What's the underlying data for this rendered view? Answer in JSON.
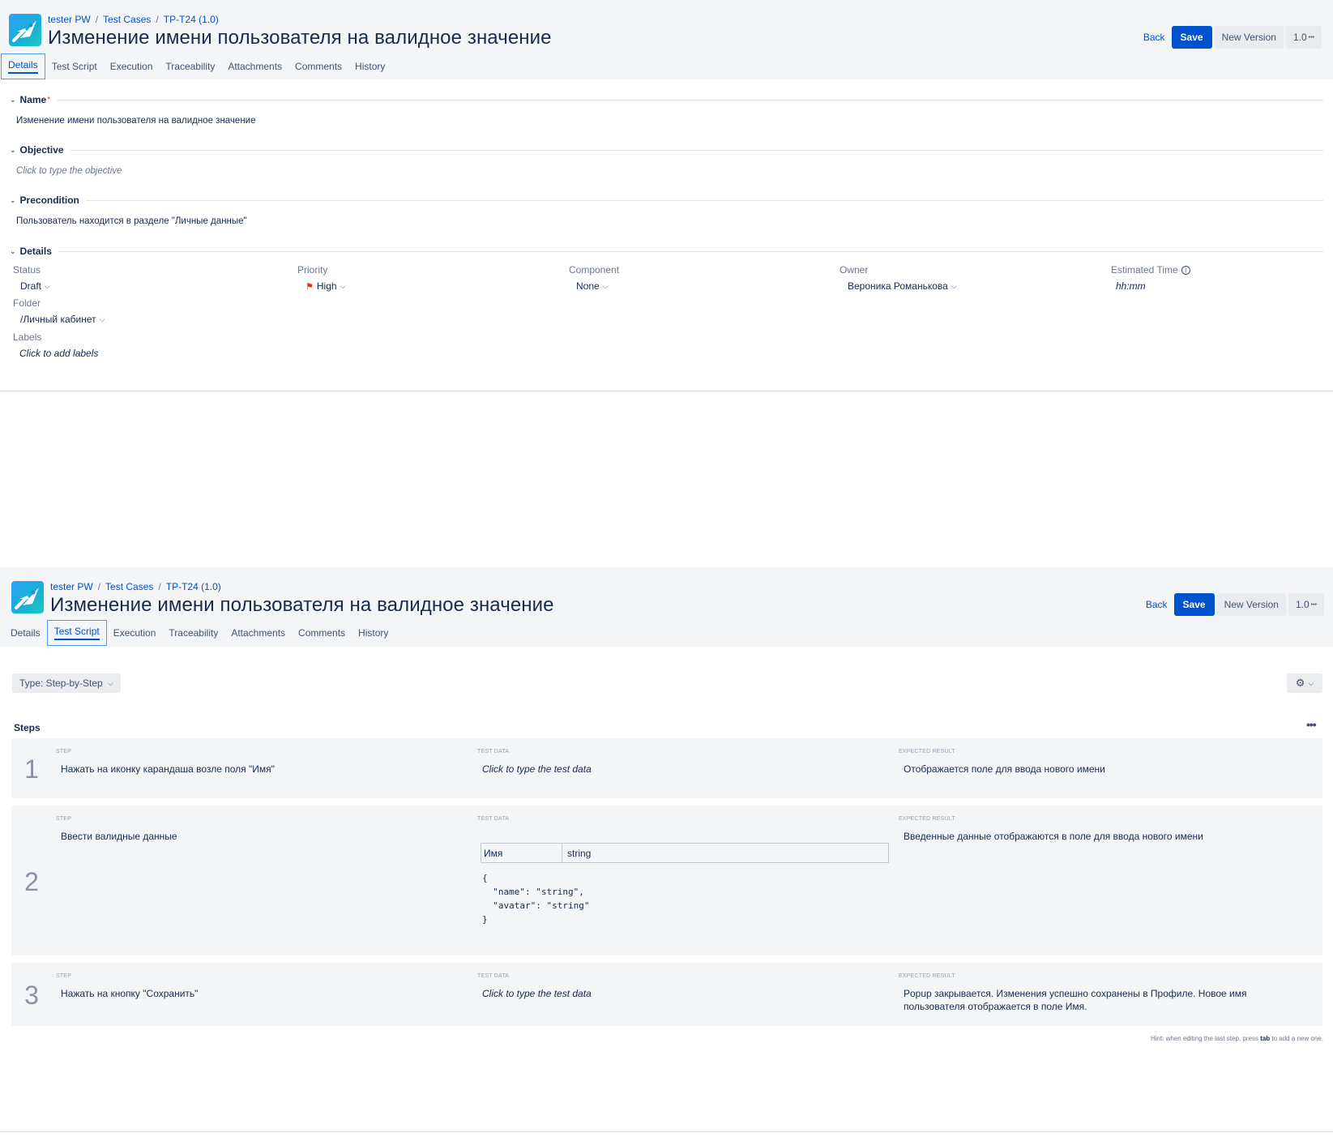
{
  "header": {
    "breadcrumb": [
      "tester PW",
      "Test Cases",
      "TP-T24 (1.0)"
    ],
    "breadcrumb_sep": "/",
    "title": "Изменение имени пользователя на валидное значение",
    "back_label": "Back",
    "save_label": "Save",
    "new_version_label": "New Version",
    "version_label": "1.0",
    "more_icon": "•••"
  },
  "tabs": [
    "Details",
    "Test Script",
    "Execution",
    "Traceability",
    "Attachments",
    "Comments",
    "History"
  ],
  "details": {
    "name_label": "Name",
    "name_required": "*",
    "name_value": "Изменение имени пользователя на валидное значение",
    "objective_label": "Objective",
    "objective_placeholder": "Click to type the objective",
    "precondition_label": "Precondition",
    "precondition_value": "Пользователь находится в разделе \"Личные данные\"",
    "details_label": "Details",
    "status_label": "Status",
    "status_value": "Draft",
    "priority_label": "Priority",
    "priority_value": "High",
    "component_label": "Component",
    "component_value": "None",
    "owner_label": "Owner",
    "owner_value": "Вероника Романькова",
    "estimated_label": "Estimated Time",
    "estimated_placeholder": "hh:mm",
    "folder_label": "Folder",
    "folder_value": "/Личный кабинет",
    "labels_label": "Labels",
    "labels_placeholder": "Click to add labels"
  },
  "script": {
    "type_label": "Type: Step-by-Step",
    "steps_title": "Steps",
    "col_step": "STEP",
    "col_test_data": "TEST DATA",
    "col_expected": "EXPECTED RESULT",
    "steps": [
      {
        "number": "1",
        "step": "Нажать на иконку карандаша возле поля \"Имя\"",
        "test_data_placeholder": "Click to type the test data",
        "expected": "Отображается поле для ввода нового имени"
      },
      {
        "number": "2",
        "step": "Ввести валидные данные",
        "test_data_table": [
          "Имя",
          "string"
        ],
        "test_data_code": "{\n  \"name\": \"string\",\n  \"avatar\": \"string\"\n}",
        "expected": "Введенные данные отображаются в поле для ввода нового имени"
      },
      {
        "number": "3",
        "step": "Нажать на кнопку \"Сохранить\"",
        "test_data_placeholder": "Click to type the test data",
        "expected": "Popup закрывается. Изменения успешно сохранены в Профиле. Новое имя пользователя отображается в поле Имя."
      }
    ],
    "hint_prefix": "Hint: when editing the last step, press",
    "hint_key": "tab",
    "hint_suffix": "to add a new one."
  }
}
